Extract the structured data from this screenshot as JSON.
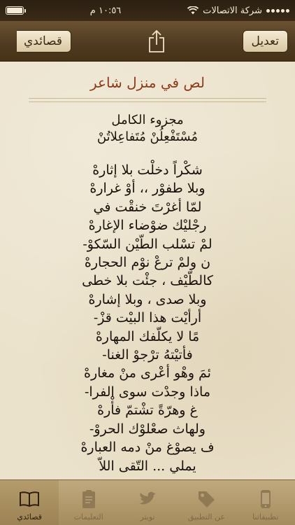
{
  "status_bar": {
    "carrier": "شركة الاتصالات",
    "time": "١٠:٥٦ م"
  },
  "nav": {
    "edit_label": "تعديل",
    "back_label": "قصائدي"
  },
  "poem": {
    "title": "لص في منزل شاعر",
    "meter_name": "مجزوء الكامل",
    "meter_pattern": "مُسْتَفْعِلُنْ مُتَفاعِلاتُنْ",
    "verses": [
      "شكْراً دخلْت بلا إثارهْ",
      "وبلا طفوْر ،، أوْ غرارهْ",
      "لمّا أغرْتَ خنقْت في",
      "رجْليْك ضوْضاء الإغارهْ",
      "لمْ تسْلب الطّيْن السّكوْ-",
      "ن ولمْ ترعْ نوْم الحجارهْ",
      "كالطّيْف ، جئْت بلا خطى",
      "وبلا صدى ، وبلا إشارهْ",
      "أرأيْت هذا البيْت قزْ-",
      "مًا لا يكلّفك المهارهْ",
      "فأتيْتهُ ترْجوْ الغنا-",
      "ئمَ وهْو أعْرى منْ مغارهْ",
      "ماذا وجدْت سوى الفرا-",
      "غ وهرّةً تشْتمّ فأْرهْ",
      "ولهاث صعْلوْك الحروْ-",
      "ف يصوْغ منْ دمه العبارهْ",
      "يملي ... التّقى اللاّ"
    ]
  },
  "tabs": [
    {
      "label": "قصائدي",
      "icon": "book-icon",
      "active": true
    },
    {
      "label": "التعليمات",
      "icon": "clipboard-icon",
      "active": false
    },
    {
      "label": "تويتر",
      "icon": "bird-icon",
      "active": false
    },
    {
      "label": "عن التطبيق",
      "icon": "tag-icon",
      "active": false
    },
    {
      "label": "تطبيقاتنا",
      "icon": "phone-icon",
      "active": false
    }
  ],
  "colors": {
    "title": "#8b3a1a",
    "nav_bar": "#4e3a20",
    "paper": "#ebe2cb"
  }
}
